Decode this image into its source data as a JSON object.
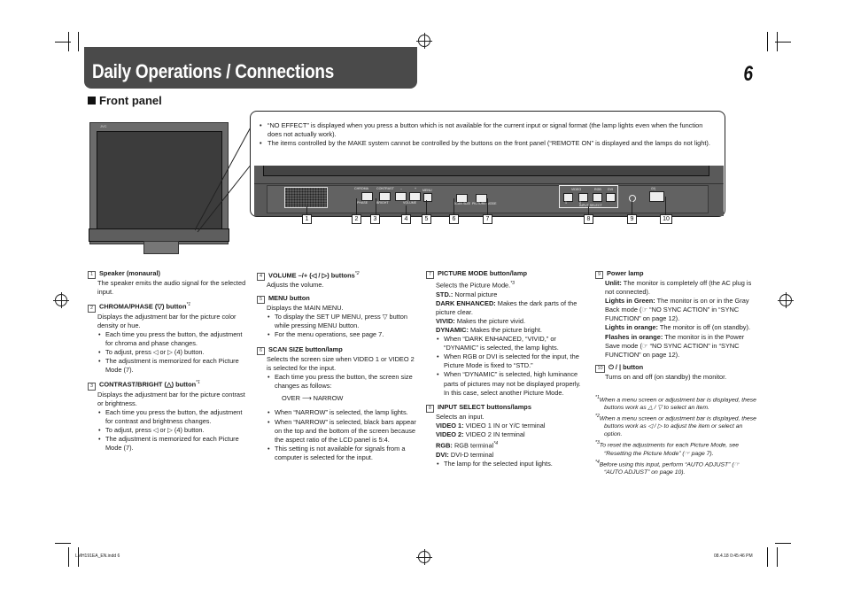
{
  "header": {
    "title": "Daily Operations / Connections",
    "page_number": "6",
    "section": "Front panel"
  },
  "callout": {
    "notes": [
      "“NO EFFECT” is displayed when you press a button which is not available for the current input or signal format (the lamp lights even when the function does not actually work).",
      "The items controlled by the MAKE system cannot be controlled by the buttons on the front panel (“REMOTE ON” is displayed and the lamps do not light)."
    ]
  },
  "panel": {
    "logo": "JVC",
    "labels": {
      "chroma": "CHROMA",
      "phase": "PHASE",
      "contrast": "CONTRAST",
      "bright": "BRIGHT",
      "volume": "VOLUME",
      "minus": "–",
      "plus": "+",
      "menu": "MENU",
      "scan_size": "SCAN SIZE",
      "picture_mode": "PICTURE MODE",
      "video": "VIDEO",
      "v1": "1",
      "v2": "2",
      "rgb": "RGB",
      "dvi": "DVI",
      "input_select": "INPUT SELECT",
      "power": "⏻/|"
    },
    "callout_numbers": [
      "1",
      "2",
      "3",
      "4",
      "5",
      "6",
      "7",
      "8",
      "9",
      "10"
    ]
  },
  "items": {
    "1": {
      "num": "1",
      "title": "Speaker (monaural)",
      "desc": "The speaker emits the audio signal for the selected input."
    },
    "2": {
      "num": "2",
      "title": "CHROMA/PHASE (▽) button",
      "sup": "*1",
      "desc": "Displays the adjustment bar for the picture color density or hue.",
      "bullets": [
        "Each time you press the button, the adjustment for chroma and phase changes.",
        "To adjust, press ◁ or ▷ (4) button.",
        "The adjustment is memorized for each Picture Mode (7)."
      ]
    },
    "3": {
      "num": "3",
      "title": "CONTRAST/BRIGHT (△) button",
      "sup": "*1",
      "desc": "Displays the adjustment bar for the picture contrast or brightness.",
      "bullets": [
        "Each time you press the button, the adjustment for contrast and brightness changes.",
        "To adjust, press ◁ or ▷ (4) button.",
        "The adjustment is memorized for each Picture Mode (7)."
      ]
    },
    "4": {
      "num": "4",
      "title": "VOLUME –/+ (◁ / ▷) buttons",
      "sup": "*2",
      "desc": "Adjusts the volume."
    },
    "5": {
      "num": "5",
      "title": "MENU button",
      "desc": "Displays the MAIN MENU.",
      "bullets": [
        "To display the SET UP MENU, press ▽ button while pressing MENU button.",
        "For the menu operations, see page 7."
      ]
    },
    "6": {
      "num": "6",
      "title": "SCAN SIZE button/lamp",
      "desc": "Selects the screen size when VIDEO 1 or VIDEO 2 is selected for the input.",
      "bullets_a": [
        "Each time you press the button, the screen size changes as follows:"
      ],
      "sequence": "OVER ⟶ NARROW",
      "bullets_b": [
        "When “NARROW” is selected, the lamp lights.",
        "When “NARROW” is selected, black bars appear on the top and the bottom of the screen because the aspect ratio of the LCD panel is 5:4.",
        "This setting is not available for signals from a computer is selected for the input."
      ]
    },
    "7": {
      "num": "7",
      "title": "PICTURE MODE button/lamp",
      "desc": "Selects the Picture Mode.",
      "sup": "*3",
      "modes": [
        {
          "k": "STD.:",
          "v": " Normal picture"
        },
        {
          "k": "DARK ENHANCED:",
          "v": " Makes the dark parts of the picture clear."
        },
        {
          "k": "VIVID:",
          "v": " Makes the picture vivid."
        },
        {
          "k": "DYNAMIC:",
          "v": " Makes the picture bright."
        }
      ],
      "bullets": [
        "When “DARK ENHANCED, “VIVID,” or “DYNAMIC” is selected, the lamp lights.",
        "When RGB or DVI is selected for the input, the Picture Mode is fixed to “STD.”",
        "When “DYNAMIC” is selected, high luminance parts of pictures may not be displayed properly. In this case, select another Picture Mode."
      ]
    },
    "8": {
      "num": "8",
      "title": "INPUT SELECT buttons/lamps",
      "desc": "Selects an input.",
      "inputs": [
        {
          "k": "VIDEO 1:",
          "v": " VIDEO 1 IN or Y/C terminal"
        },
        {
          "k": "VIDEO 2:",
          "v": " VIDEO 2 IN terminal"
        },
        {
          "k": "RGB:",
          "v": " RGB terminal",
          "sup": "*4"
        },
        {
          "k": "DVI:",
          "v": " DVI-D terminal"
        }
      ],
      "bullets": [
        "The lamp for the selected input lights."
      ]
    },
    "9": {
      "num": "9",
      "title": "Power lamp",
      "states": [
        {
          "k": "Unlit:",
          "v": " The monitor is completely off (the AC plug is not connected)."
        },
        {
          "k": "Lights in Green:",
          "v": " The monitor is on or in the Gray Back mode (☞ “NO SYNC ACTION” in “SYNC FUNCTION” on page 12)."
        },
        {
          "k": "Lights in orange:",
          "v": " The monitor is off (on standby)."
        },
        {
          "k": "Flashes in orange:",
          "v": " The monitor is in the Power Save mode (☞ “NO SYNC ACTION” in “SYNC FUNCTION” on page 12)."
        }
      ]
    },
    "10": {
      "num": "10",
      "title": "⏻ / | button",
      "desc": "Turns on and off (on standby) the monitor."
    }
  },
  "footnotes": [
    {
      "mark": "*1",
      "text": "When a menu screen or adjustment bar is displayed, these buttons work as △ / ▽ to select an item."
    },
    {
      "mark": "*2",
      "text": "When a menu screen or adjustment bar is displayed, these buttons work as ◁ / ▷ to adjust the item or select an option."
    },
    {
      "mark": "*3",
      "text": "To reset the adjustments for each Picture Mode, see “Resetting the Picture Mode” (☞ page 7)."
    },
    {
      "mark": "*4",
      "text": "Before using this input, perform “AUTO ADJUST” (☞ “AUTO ADJUST” on page 10)."
    }
  ],
  "footer": {
    "file": "LMH191EA_EN.indd   6",
    "timestamp": "08.4.18   0:45:46 PM"
  }
}
